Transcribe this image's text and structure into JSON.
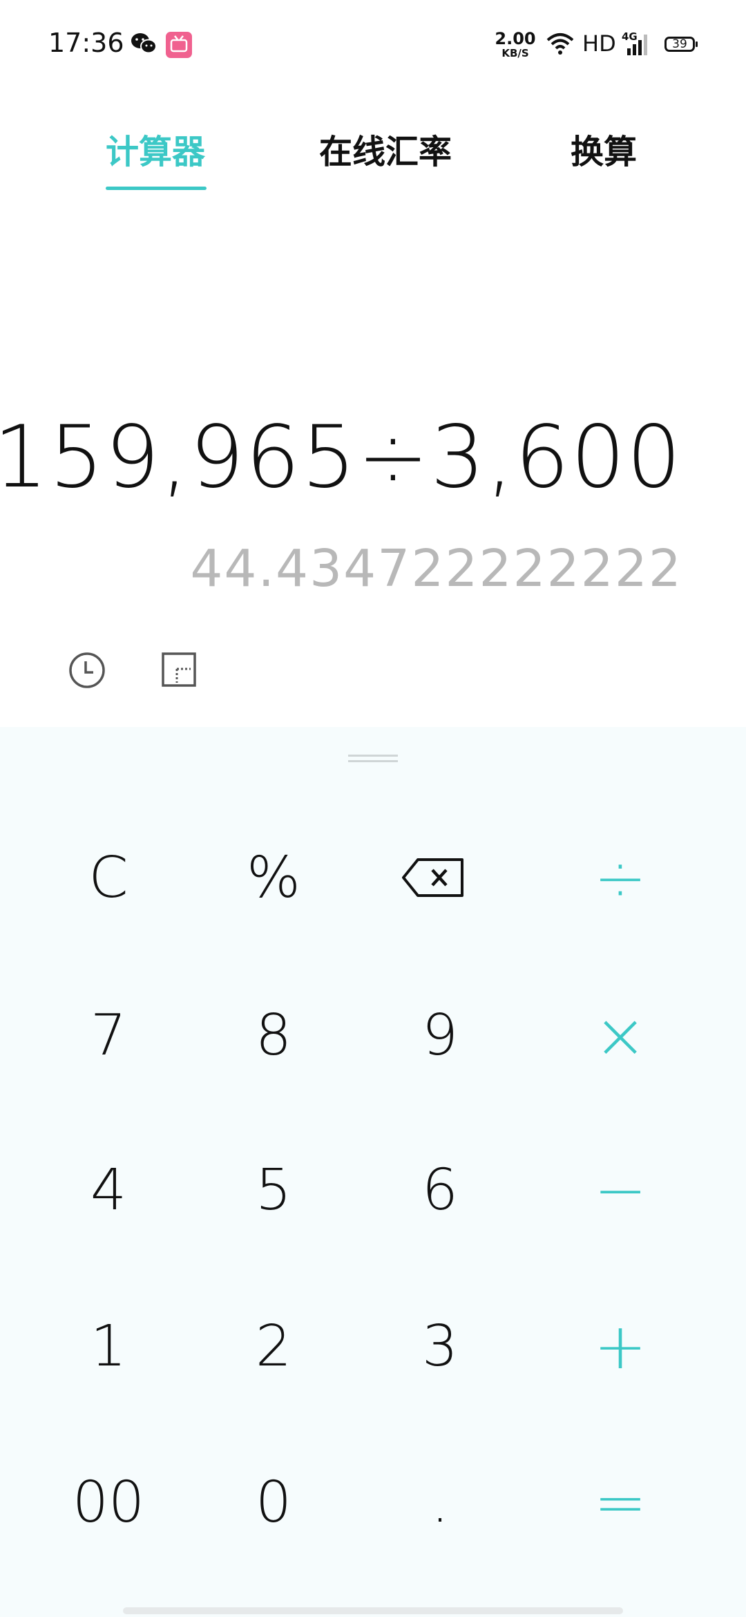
{
  "status_bar": {
    "time": "17:36",
    "net_speed_value": "2.00",
    "net_speed_unit": "KB/S",
    "hd": "HD",
    "network_type": "4G",
    "battery": "39"
  },
  "tabs": [
    {
      "label": "计算器",
      "active": true
    },
    {
      "label": "在线汇率",
      "active": false
    },
    {
      "label": "换算",
      "active": false
    }
  ],
  "display": {
    "expression": "159,965÷3,600",
    "result": "44.434722222222"
  },
  "keypad": {
    "rows": [
      [
        "C",
        "%",
        "backspace",
        "÷"
      ],
      [
        "7",
        "8",
        "9",
        "×"
      ],
      [
        "4",
        "5",
        "6",
        "−"
      ],
      [
        "1",
        "2",
        "3",
        "+"
      ],
      [
        "00",
        "0",
        ".",
        "="
      ]
    ],
    "labels": {
      "clear": "C",
      "percent": "%",
      "divide": "÷",
      "seven": "7",
      "eight": "8",
      "nine": "9",
      "multiply": "×",
      "four": "4",
      "five": "5",
      "six": "6",
      "minus": "−",
      "one": "1",
      "two": "2",
      "three": "3",
      "plus": "+",
      "double_zero": "00",
      "zero": "0",
      "dot": ".",
      "equals": "="
    }
  },
  "colors": {
    "accent": "#3cc8c6",
    "result_text": "#b8b8b8",
    "keypad_bg": "#f6fcfd"
  },
  "icons": {
    "history": "clock-icon",
    "scientific": "scientific-mode-icon",
    "backspace": "backspace-icon"
  }
}
